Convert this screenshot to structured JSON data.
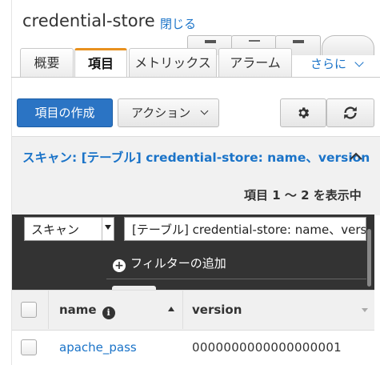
{
  "header": {
    "title": "credential-store",
    "close_label": "閉じる"
  },
  "tabs": [
    {
      "label": "概要",
      "active": false
    },
    {
      "label": "項目",
      "active": true
    },
    {
      "label": "メトリックス",
      "active": false
    },
    {
      "label": "アラーム",
      "active": false
    }
  ],
  "more_tab": {
    "label": "さらに"
  },
  "toolbar": {
    "create_item_label": "項目の作成",
    "action_label": "アクション"
  },
  "scan": {
    "header_text": "スキャン: [テーブル] credential-store: name、version",
    "count_text": "項目 1 〜 2 を表示中",
    "mode_value": "スキャン",
    "target_value": "[テーブル] credential-store: name、version",
    "add_filter_label": "フィルターの追加"
  },
  "table": {
    "columns": [
      "name",
      "version"
    ],
    "rows": [
      {
        "name": "apache_pass",
        "version": "0000000000000000001"
      }
    ]
  },
  "colors": {
    "primary_button": "#2b74c4",
    "link": "#1a73c8",
    "active_tab_accent": "#e8911f",
    "filter_panel_bg": "#333333"
  }
}
